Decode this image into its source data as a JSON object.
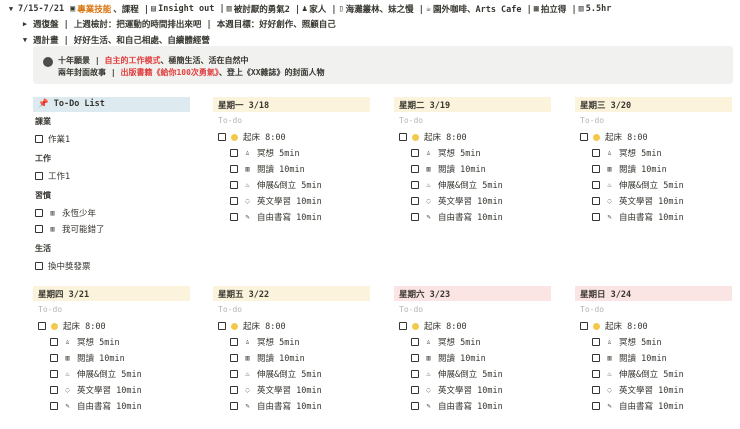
{
  "header": {
    "toggle_icon": "triangle-down-icon",
    "date_range": "7/15-7/21",
    "segments": [
      {
        "icon": "tv-icon",
        "text": "專業技能",
        "color": "#d9730d"
      },
      {
        "icon": "",
        "text": "、課程 |",
        "color": ""
      },
      {
        "icon": "clapper-icon",
        "text": "Insight out |",
        "color": ""
      },
      {
        "icon": "book-icon",
        "text": "被討厭的勇氣2 |",
        "color": ""
      },
      {
        "icon": "family-icon",
        "text": "家人 |",
        "color": ""
      },
      {
        "icon": "person-icon",
        "text": "海灘叢林、妹之慢 |",
        "color": ""
      },
      {
        "icon": "coffee-icon",
        "text": "園外咖啡、Arts Cafe |",
        "color": ""
      },
      {
        "icon": "camera-icon",
        "text": "拍立得 |",
        "color": ""
      },
      {
        "icon": "book-icon",
        "text": "5.5hr",
        "color": ""
      }
    ]
  },
  "weekly_review": {
    "text": "週復盤 | 上週檢討：把運動的時間排出來吧 | 本週目標：好好創作、照顧自己"
  },
  "weekly_plan": {
    "text": "週計畫 | 好好生活、和自己相處、自續體經營"
  },
  "callout": {
    "line1_label": "十年願景 |",
    "line1_highlight": "自主的工作模式",
    "line1_rest": "、極簡生活、活在自然中",
    "line2_label": "兩年封面故事 |",
    "line2_highlight": "出版書籍《給你100次勇氣》",
    "line2_rest": "、登上《XX雜誌》的封面人物"
  },
  "todo_list": {
    "title": "To-Do List",
    "sections": [
      {
        "label": "課業",
        "items": [
          "作業1"
        ]
      },
      {
        "label": "工作",
        "items": [
          "工作1"
        ]
      },
      {
        "label": "習慣",
        "items": [
          "永恆少年",
          "我可能錯了"
        ]
      },
      {
        "label": "生活",
        "items": [
          "換中獎發票"
        ]
      }
    ]
  },
  "day_placeholder": "To-do",
  "routine": {
    "wake": "起床 8:00",
    "subitems": [
      {
        "icon": "meditation-icon",
        "text": "冥想 5min"
      },
      {
        "icon": "book-icon",
        "text": "閱讀 10min"
      },
      {
        "icon": "stretch-icon",
        "text": "伸展&倒立 5min"
      },
      {
        "icon": "headphones-icon",
        "text": "英文學習 10min"
      },
      {
        "icon": "pencil-icon",
        "text": "自由書寫 10min"
      }
    ]
  },
  "days": [
    {
      "label": "星期一 3/18",
      "color": "#fbf3db"
    },
    {
      "label": "星期二 3/19",
      "color": "#fbf3db"
    },
    {
      "label": "星期三 3/20",
      "color": "#fbf3db"
    },
    {
      "label": "星期四 3/21",
      "color": "#fbf3db"
    },
    {
      "label": "星期五 3/22",
      "color": "#fbf3db"
    },
    {
      "label": "星期六 3/23",
      "color": "#fbe4e4"
    },
    {
      "label": "星期日 3/24",
      "color": "#fbe4e4"
    }
  ]
}
